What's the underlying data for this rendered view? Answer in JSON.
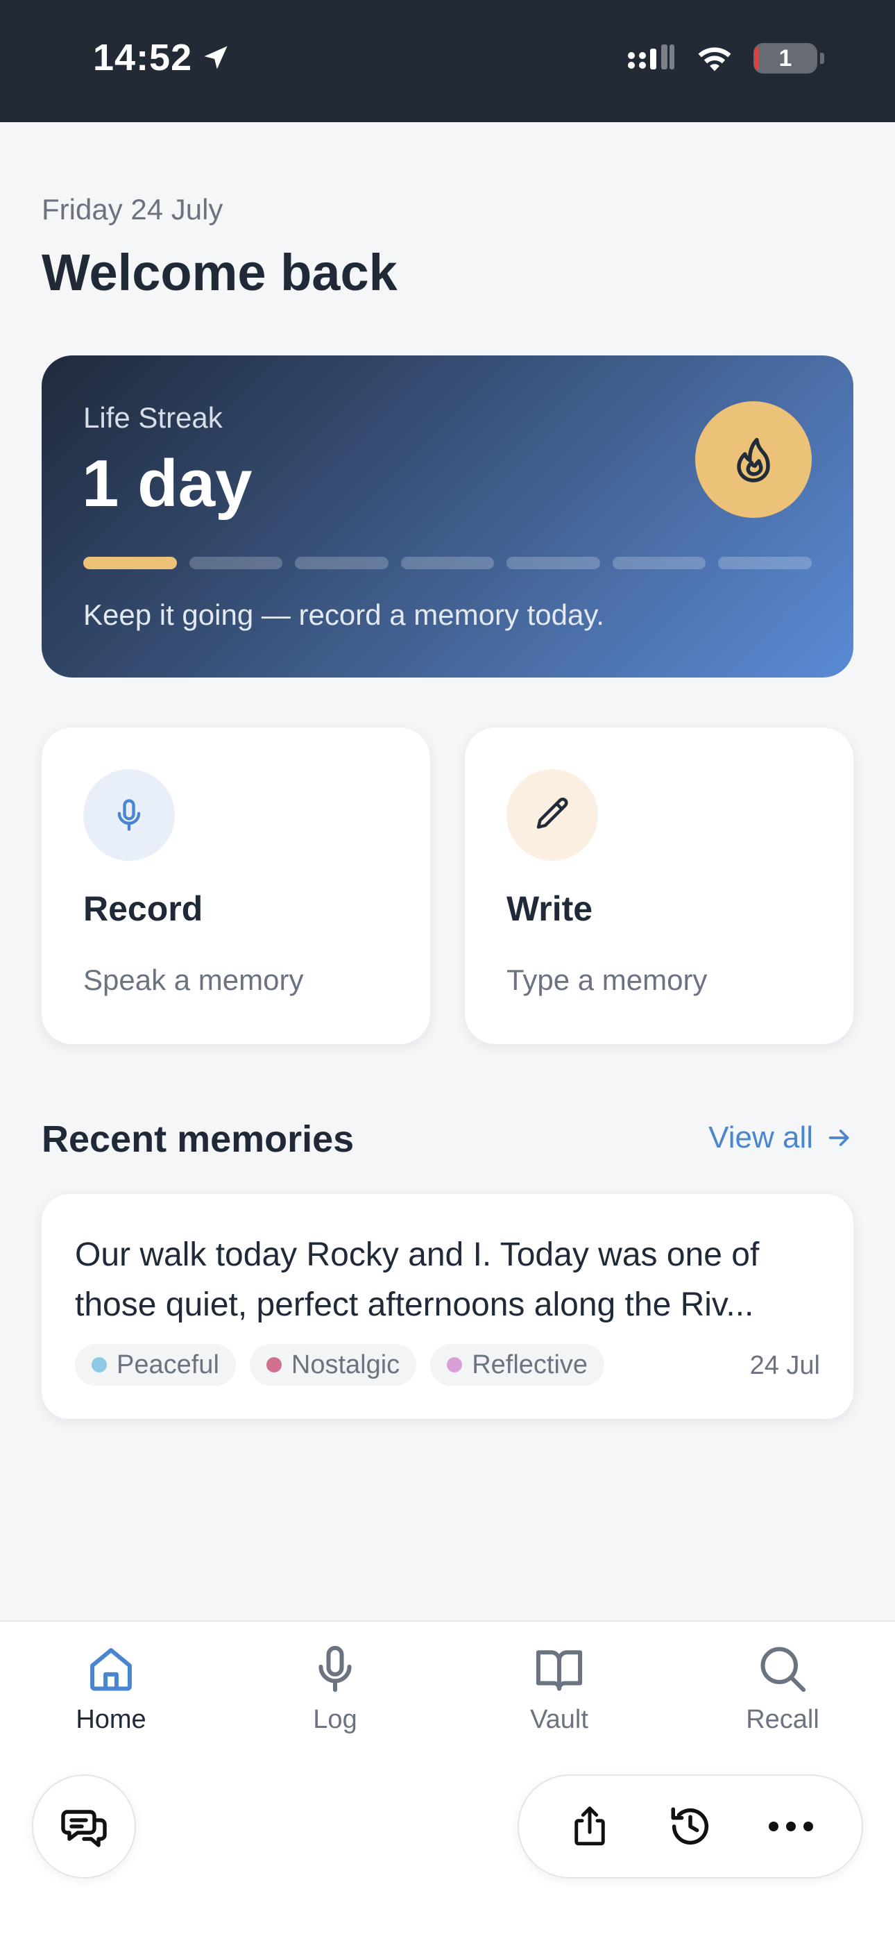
{
  "status_bar": {
    "time": "14:52",
    "battery_level": "1"
  },
  "header": {
    "date": "Friday 24 July",
    "title": "Welcome back"
  },
  "streak": {
    "label": "Life Streak",
    "value": "1 day",
    "days_completed": 1,
    "days_total": 7,
    "note": "Keep it going — record a memory today.",
    "accent_color": "#ecc178"
  },
  "actions": {
    "record": {
      "title": "Record",
      "subtitle": "Speak a memory"
    },
    "write": {
      "title": "Write",
      "subtitle": "Type a memory"
    }
  },
  "recent": {
    "title": "Recent memories",
    "view_all": "View all",
    "memories": [
      {
        "text": "Our walk today Rocky and I. Today was one of those quiet, perfect afternoons along the Riv...",
        "tags": [
          {
            "label": "Peaceful",
            "color": "#8ecae6"
          },
          {
            "label": "Nostalgic",
            "color": "#d0708c"
          },
          {
            "label": "Reflective",
            "color": "#d9a0d8"
          }
        ],
        "date": "24 Jul"
      }
    ]
  },
  "nav": {
    "items": [
      {
        "label": "Home",
        "icon": "home-icon",
        "active": true
      },
      {
        "label": "Log",
        "icon": "microphone-icon",
        "active": false
      },
      {
        "label": "Vault",
        "icon": "book-icon",
        "active": false
      },
      {
        "label": "Recall",
        "icon": "search-icon",
        "active": false
      }
    ]
  },
  "browser_toolbar": {
    "icons": [
      "chat-icon",
      "share-icon",
      "history-icon",
      "more-icon"
    ]
  },
  "colors": {
    "primary": "#4a85cf",
    "text_dark": "#1f2937",
    "text_muted": "#6b7280"
  }
}
